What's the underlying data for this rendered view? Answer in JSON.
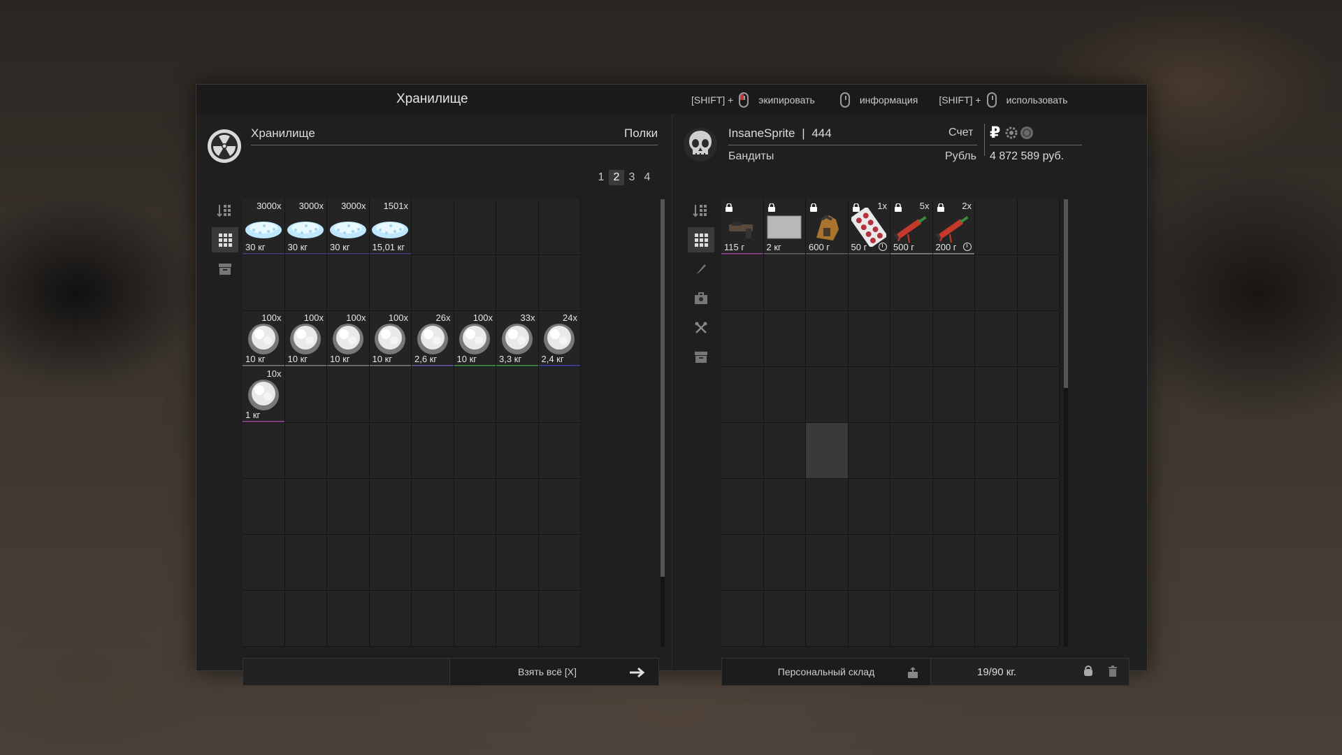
{
  "window": {
    "title": "Хранилище"
  },
  "hints": [
    {
      "key": "[SHIFT] +",
      "label": "экипировать",
      "mouse": "left-click"
    },
    {
      "key": "",
      "label": "информация",
      "mouse": "mouse"
    },
    {
      "key": "[SHIFT] +",
      "label": "использовать",
      "mouse": "right-click"
    }
  ],
  "storage": {
    "title": "Хранилище",
    "shelves_label": "Полки",
    "pages": [
      "1",
      "2",
      "3",
      "4"
    ],
    "active_page": "2",
    "take_all_label": "Взять всё [X]",
    "items": [
      {
        "kind": "crystal",
        "count": "3000x",
        "weight": "30 кг",
        "row": 0,
        "col": 0,
        "line": "#3b3b6b"
      },
      {
        "kind": "crystal",
        "count": "3000x",
        "weight": "30 кг",
        "row": 0,
        "col": 1,
        "line": "#3b3b6b"
      },
      {
        "kind": "crystal",
        "count": "3000x",
        "weight": "30 кг",
        "row": 0,
        "col": 2,
        "line": "#3b3b6b"
      },
      {
        "kind": "crystal",
        "count": "1501x",
        "weight": "15,01 кг",
        "row": 0,
        "col": 3,
        "line": "#3b3b6b"
      },
      {
        "kind": "cloud",
        "count": "100x",
        "weight": "10 кг",
        "row": 2,
        "col": 0,
        "line": "#6b6b6b"
      },
      {
        "kind": "cloud",
        "count": "100x",
        "weight": "10 кг",
        "row": 2,
        "col": 1,
        "line": "#6b6b6b"
      },
      {
        "kind": "cloud",
        "count": "100x",
        "weight": "10 кг",
        "row": 2,
        "col": 2,
        "line": "#6b6b6b"
      },
      {
        "kind": "cloud",
        "count": "100x",
        "weight": "10 кг",
        "row": 2,
        "col": 3,
        "line": "#6b6b6b"
      },
      {
        "kind": "cloud",
        "count": "26x",
        "weight": "2,6 кг",
        "row": 2,
        "col": 4,
        "line": "#5a4b8b"
      },
      {
        "kind": "cloud",
        "count": "100x",
        "weight": "10 кг",
        "row": 2,
        "col": 5,
        "line": "#3f7a3f"
      },
      {
        "kind": "cloud",
        "count": "33x",
        "weight": "3,3 кг",
        "row": 2,
        "col": 6,
        "line": "#3f7a3f"
      },
      {
        "kind": "cloud",
        "count": "24x",
        "weight": "2,4 кг",
        "row": 2,
        "col": 7,
        "line": "#3b3b8b"
      },
      {
        "kind": "cloud",
        "count": "10x",
        "weight": "1 кг",
        "row": 3,
        "col": 0,
        "line": "#7a3f7a"
      }
    ]
  },
  "player": {
    "name": "InsaneSprite",
    "separator": "|",
    "level": "444",
    "faction": "Бандиты",
    "account_label": "Счет",
    "currency_label": "Рубль",
    "currency_symbol": "₽",
    "balance": "4 872 589 руб.",
    "personal_storage_label": "Персональный склад",
    "weight_capacity": "19/90 кг.",
    "items": [
      {
        "kind": "weapon",
        "weight": "115 г",
        "count": "",
        "locked": true,
        "timer": false,
        "col": 0,
        "line": "#7a3f7a"
      },
      {
        "kind": "plate",
        "weight": "2 кг",
        "count": "",
        "locked": true,
        "timer": false,
        "col": 1,
        "line": "#555"
      },
      {
        "kind": "glove",
        "weight": "600 г",
        "count": "",
        "locked": true,
        "timer": false,
        "col": 2,
        "line": "#555"
      },
      {
        "kind": "pills",
        "weight": "50 г",
        "count": "1x",
        "locked": true,
        "timer": true,
        "col": 3,
        "line": "#555"
      },
      {
        "kind": "syringe",
        "weight": "500 г",
        "count": "5x",
        "locked": true,
        "timer": false,
        "col": 4,
        "line": "#777"
      },
      {
        "kind": "syringe",
        "weight": "200 г",
        "count": "2x",
        "locked": true,
        "timer": true,
        "col": 5,
        "line": "#777"
      }
    ]
  }
}
